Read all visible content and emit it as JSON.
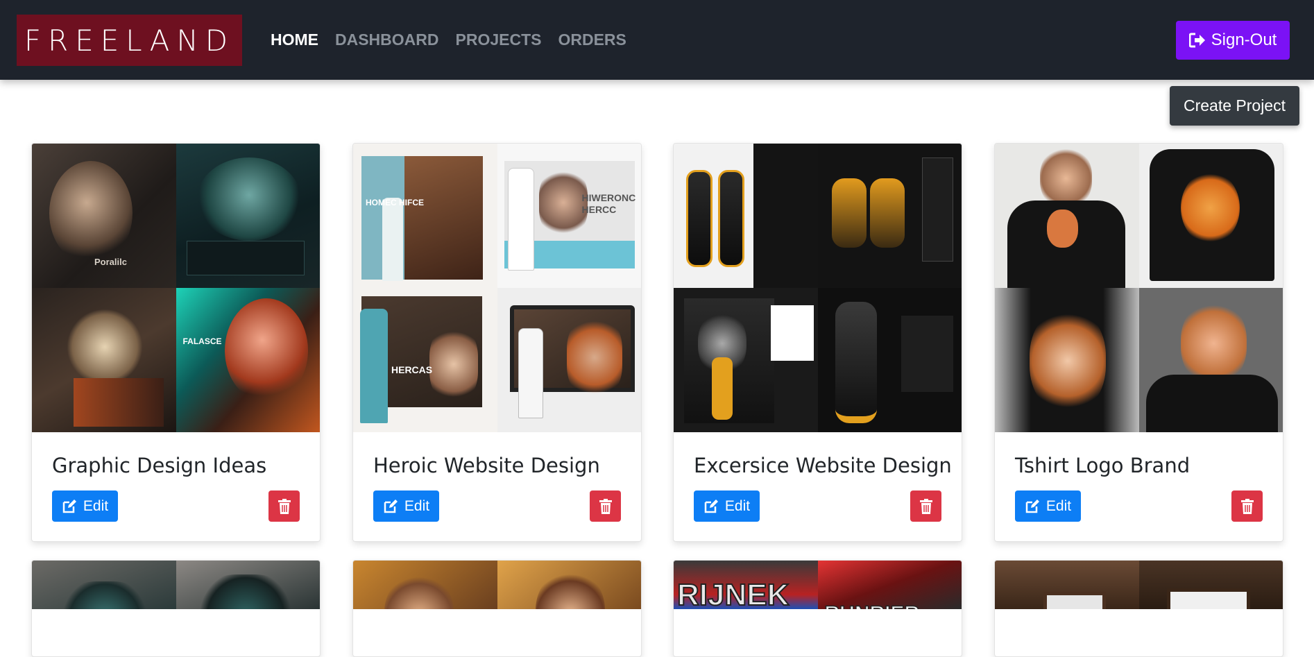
{
  "brand": {
    "name": "FREELAND"
  },
  "nav": {
    "items": [
      {
        "label": "HOME",
        "active": true
      },
      {
        "label": "DASHBOARD",
        "active": false
      },
      {
        "label": "PROJECTS",
        "active": false
      },
      {
        "label": "ORDERS",
        "active": false
      }
    ],
    "signout_label": "Sign-Out",
    "signout_icon": "sign-out-icon"
  },
  "actions": {
    "create_project_label": "Create Project"
  },
  "projects": [
    {
      "title": "Graphic Design Ideas",
      "edit_label": "Edit",
      "edit_icon": "edit-icon",
      "delete_icon": "trash-icon",
      "thumb_texts": [
        "Poralilc",
        "FALASCE"
      ]
    },
    {
      "title": "Heroic Website Design",
      "edit_label": "Edit",
      "edit_icon": "edit-icon",
      "delete_icon": "trash-icon",
      "thumb_texts": [
        "HOMEC HIFCE",
        "HIWERONC HERCC",
        "HERCAS"
      ]
    },
    {
      "title": "Excersice Website Design",
      "edit_label": "Edit",
      "edit_icon": "edit-icon",
      "delete_icon": "trash-icon",
      "thumb_texts": []
    },
    {
      "title": "Tshirt Logo Brand",
      "edit_label": "Edit",
      "edit_icon": "edit-icon",
      "delete_icon": "trash-icon",
      "thumb_texts": []
    },
    {
      "thumb_texts": []
    },
    {
      "thumb_texts": []
    },
    {
      "thumb_texts": [
        "RIJNEK",
        "RUNRIER"
      ]
    },
    {
      "thumb_texts": []
    }
  ],
  "colors": {
    "navbar": "#1e232c",
    "brand_bg": "#6e1020",
    "signout": "#7b12f5",
    "edit": "#0d7ef5",
    "delete": "#dc3545",
    "create": "#343a40"
  }
}
